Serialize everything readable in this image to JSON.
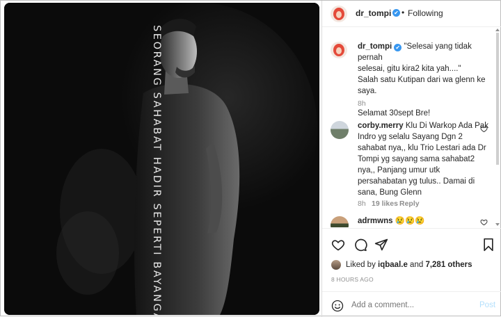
{
  "post": {
    "overlay_text": "SEORANG SAHABAT HADIR SEPERTI BAYANGAN"
  },
  "header": {
    "username": "dr_tompi",
    "verified_mark": "✔",
    "separator": "•",
    "follow_status": "Following",
    "more_icon": "more-horizontal-icon"
  },
  "caption": {
    "username": "dr_tompi",
    "line1": "\"Selesai yang tidak pernah",
    "line2": "selesai, gitu kira2 kita yah....\"",
    "line3": "Salah satu Kutipan dari wa glenn ke saya.",
    "line4": "Selamat 30sept Bre!",
    "time": "8h"
  },
  "comments": [
    {
      "username": "corby.merry",
      "lines": [
        "Klu Di Warkop Ada Pak",
        "Indro yg selalu Sayang Dgn 2",
        "sahabat nya,, klu Trio Lestari ada Dr",
        "Tompi yg sayang sama sahabat2",
        "nya,, Panjang umur utk",
        "persahabatan yg tulus.. Damai di",
        "sana, Bung Glenn"
      ],
      "time": "8h",
      "likes": "19 likes",
      "reply": "Reply"
    },
    {
      "username": "adrmwns",
      "text": "😢😢😢"
    }
  ],
  "actions": {
    "liked_by_prefix": "Liked by ",
    "liked_by_user": "iqbaal.e",
    "liked_by_suffix": " and ",
    "liked_by_others": "7,281 others",
    "timestamp": "8 HOURS AGO"
  },
  "add_comment": {
    "placeholder": "Add a comment...",
    "post_label": "Post"
  },
  "colors": {
    "accent": "#3897f0",
    "muted": "#8e8e8e"
  }
}
